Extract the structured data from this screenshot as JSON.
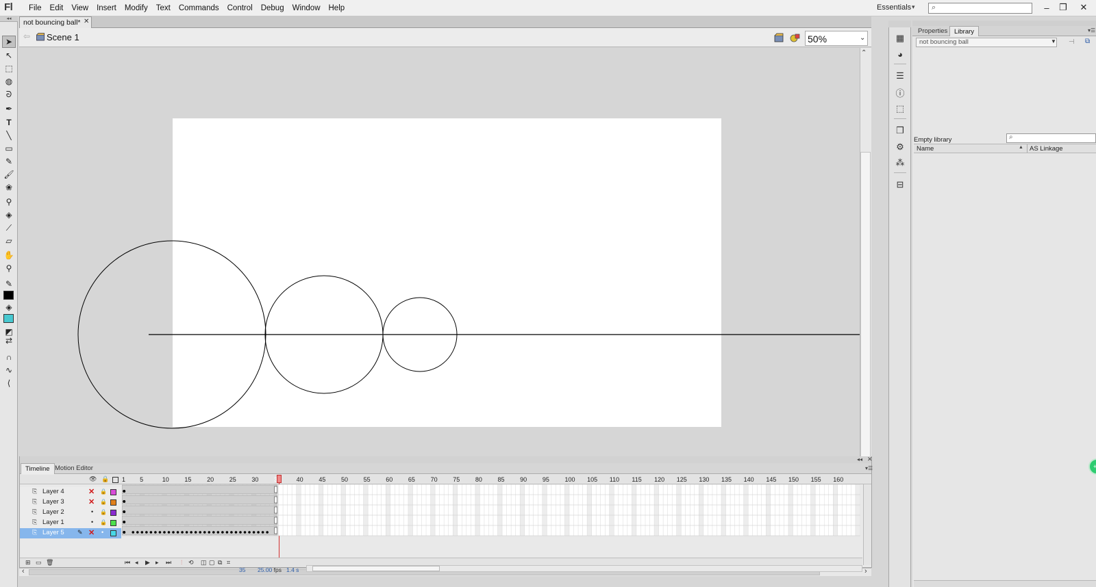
{
  "app": {
    "logo": "Fl",
    "menus": [
      "File",
      "Edit",
      "View",
      "Insert",
      "Modify",
      "Text",
      "Commands",
      "Control",
      "Debug",
      "Window",
      "Help"
    ],
    "workspace": "Essentials",
    "window_controls": [
      "–",
      "❐",
      "✕"
    ]
  },
  "document": {
    "tab_label": "not bouncing ball*",
    "scene_label": "Scene 1",
    "zoom": "50%"
  },
  "stage": {
    "background": "#ffffff",
    "pasteboard": "#d6d6d6"
  },
  "timeline": {
    "tabs": [
      "Timeline",
      "Motion Editor"
    ],
    "frame_numbers": [
      "1",
      "5",
      "10",
      "15",
      "20",
      "25",
      "30",
      "35",
      "40",
      "45",
      "50",
      "55",
      "60",
      "65",
      "70",
      "75",
      "80",
      "85",
      "90",
      "95",
      "100",
      "105",
      "110",
      "115",
      "120",
      "125",
      "130",
      "135",
      "140",
      "145",
      "150",
      "155",
      "160"
    ],
    "current_frame_marker": "35",
    "layers": [
      {
        "name": "Layer 4",
        "color": "#d84cd8",
        "visible": false,
        "selected": false
      },
      {
        "name": "Layer 3",
        "color": "#e0801c",
        "visible": false,
        "selected": false
      },
      {
        "name": "Layer 2",
        "color": "#8a2ad0",
        "visible": true,
        "selected": false
      },
      {
        "name": "Layer 1",
        "color": "#4ce04c",
        "visible": true,
        "selected": false
      },
      {
        "name": "Layer 5",
        "color": "#48d8e8",
        "visible": false,
        "selected": true
      }
    ],
    "status": {
      "frame": "35",
      "fps": "25.00",
      "fps_unit": "fps",
      "time": "1.4 s"
    }
  },
  "panels": {
    "tabs": [
      "Properties",
      "Library"
    ],
    "library": {
      "document_select": "not bouncing ball",
      "item_count": "Empty library",
      "search_placeholder": "",
      "columns": [
        "Name",
        "AS Linkage"
      ]
    }
  },
  "colors": {
    "stroke": "#000000",
    "fill": "#48c8d0",
    "selection": "#86b6ec",
    "playhead": "#d23030"
  }
}
